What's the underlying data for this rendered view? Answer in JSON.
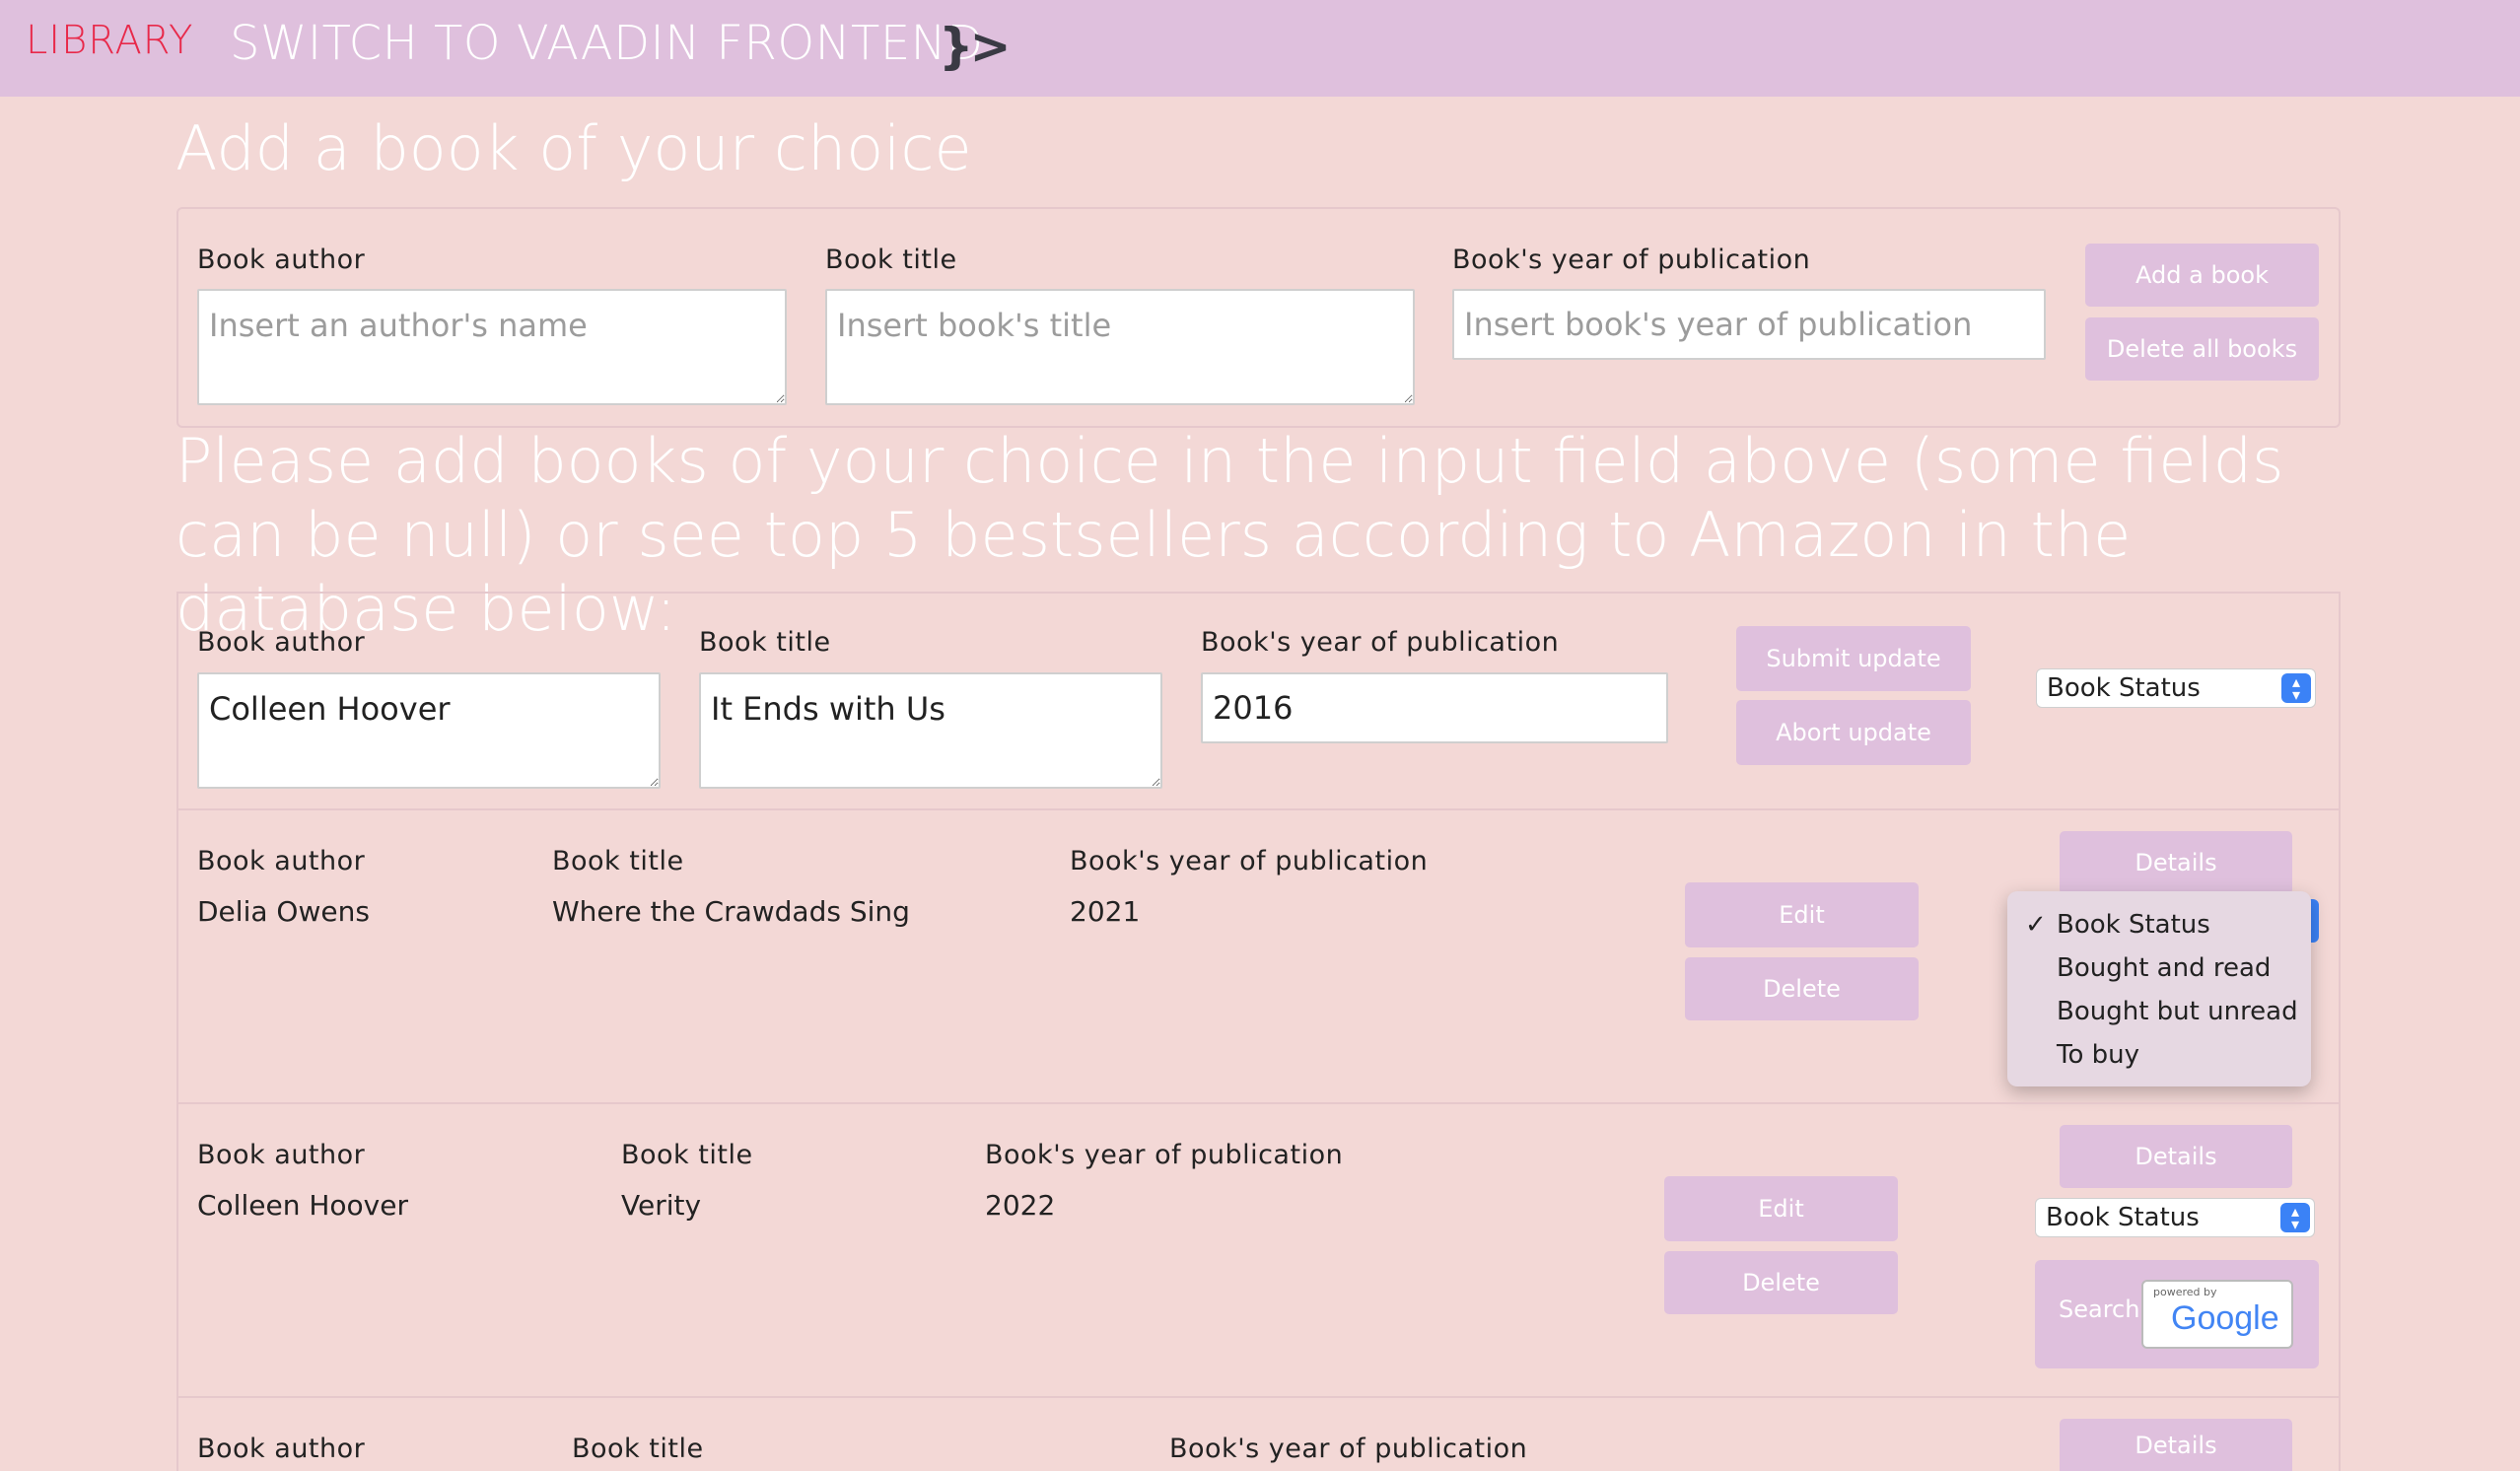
{
  "nav": {
    "brand": "LIBRARY",
    "switch_label": "SWITCH TO VAADIN FRONTEND",
    "vaadin_logo_text": "}>"
  },
  "add_section": {
    "heading": "Add a book of your choice",
    "author_label": "Book author",
    "author_placeholder": "Insert an author's name",
    "title_label": "Book title",
    "title_placeholder": "Insert book's title",
    "year_label": "Book's year of publication",
    "year_placeholder": "Insert book's year of publication",
    "add_button": "Add a book",
    "delete_all_button": "Delete all books"
  },
  "info_text": "Please add books of your choice in the input field above (some fields can be null) or see top 5 bestsellers according to Amazon in the database below:",
  "edit_row": {
    "author_label": "Book author",
    "author_value": "Colleen Hoover",
    "title_label": "Book title",
    "title_value": "It Ends with Us",
    "year_label": "Book's year of publication",
    "year_value": "2016",
    "submit_button": "Submit update",
    "abort_button": "Abort update",
    "status_select": "Book Status"
  },
  "books": [
    {
      "author_label": "Book author",
      "author": "Delia Owens",
      "title_label": "Book title",
      "title": "Where the Crawdads Sing",
      "year_label": "Book's year of publication",
      "year": "2021",
      "details_button": "Details",
      "edit_button": "Edit",
      "delete_button": "Delete"
    },
    {
      "author_label": "Book author",
      "author": "Colleen Hoover",
      "title_label": "Book title",
      "title": "Verity",
      "year_label": "Book's year of publication",
      "year": "2022",
      "details_button": "Details",
      "edit_button": "Edit",
      "delete_button": "Delete",
      "status_select": "Book Status",
      "search_label": "Search",
      "google_powered": "powered by",
      "google_word": "Google"
    },
    {
      "author_label": "Book author",
      "title_label": "Book title",
      "year_label": "Book's year of publication",
      "details_button": "Details"
    }
  ],
  "status_dropdown": {
    "check_mark": "✓",
    "options": [
      "Book Status",
      "Bought and read",
      "Bought but unread",
      "To buy"
    ],
    "selected": "Book Status"
  },
  "colors": {
    "background": "#f3d8d6",
    "nav": "#dfc0dd",
    "brand": "#e8294a",
    "button": "#dfc0dd"
  }
}
